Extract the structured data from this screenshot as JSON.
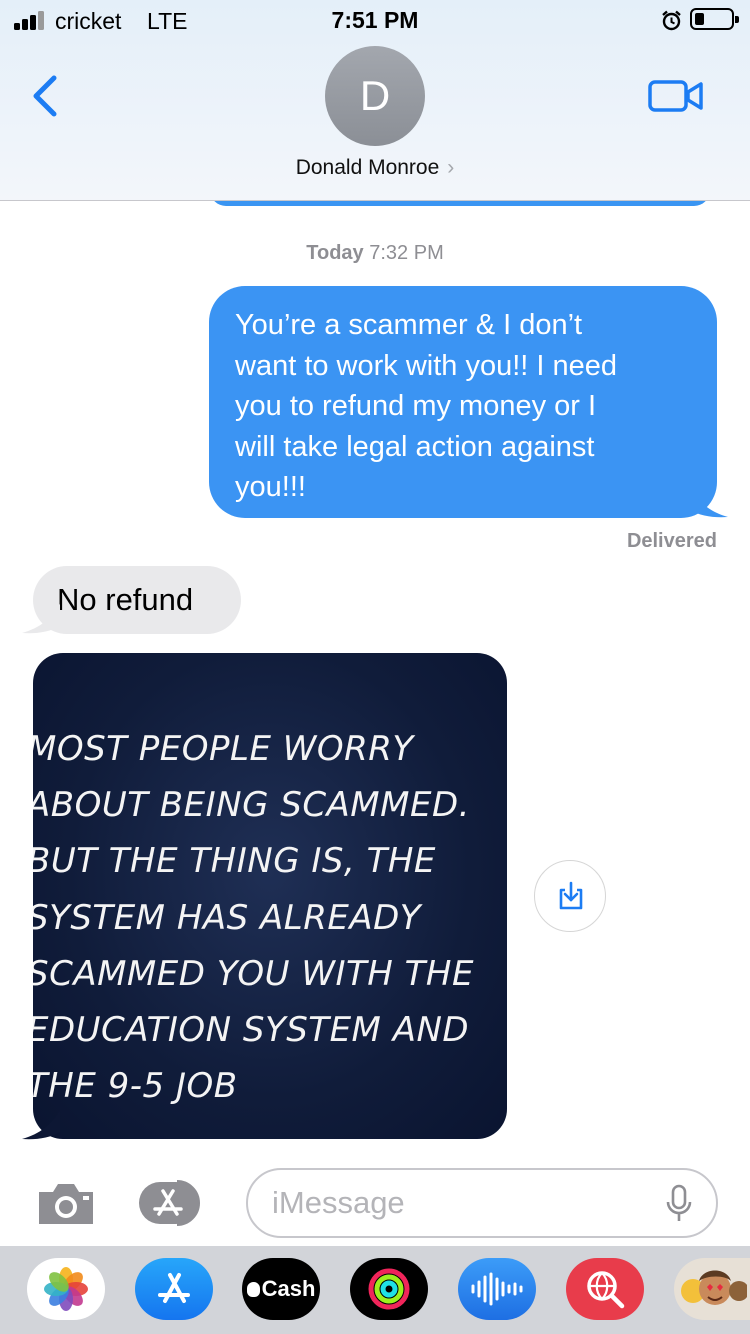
{
  "status_bar": {
    "carrier": "cricket",
    "network": "LTE",
    "time": "7:51 PM",
    "battery_level": 0.25
  },
  "header": {
    "avatar_initial": "D",
    "contact_name": "Donald Monroe",
    "chevron": "›",
    "back_icon": "chevron-left-icon",
    "video_icon": "video-camera-icon"
  },
  "conversation": {
    "timestamp_day": "Today",
    "timestamp_time": "7:32 PM",
    "outgoing": {
      "lines": [
        "You’re a scammer & I don’t",
        "want to work with you!! I need",
        "you to refund my money or I",
        "will take legal action against",
        "you!!!"
      ],
      "status": "Delivered"
    },
    "incoming_text": "No refund",
    "incoming_image": {
      "lines": [
        "MOST PEOPLE WORRY",
        "ABOUT BEING SCAMMED.",
        "BUT THE THING IS, THE",
        "SYSTEM HAS ALREADY",
        "SCAMMED YOU WITH THE",
        "EDUCATION SYSTEM AND",
        "THE 9-5 JOB"
      ],
      "save_icon": "save-download-icon"
    }
  },
  "input_bar": {
    "placeholder": "iMessage",
    "camera_icon": "camera-icon",
    "apps_icon": "app-store-icon",
    "mic_icon": "microphone-icon"
  },
  "app_drawer": {
    "apps": [
      "Photos",
      "App Store",
      "Cash",
      "Activity",
      "Audio",
      "Search",
      "Memoji"
    ],
    "cash_label": "Cash"
  },
  "colors": {
    "outgoing_bubble": "#3b94f3",
    "incoming_bubble": "#e9e9eb",
    "accent": "#1c7cf3",
    "image_background": "#101c3a"
  }
}
